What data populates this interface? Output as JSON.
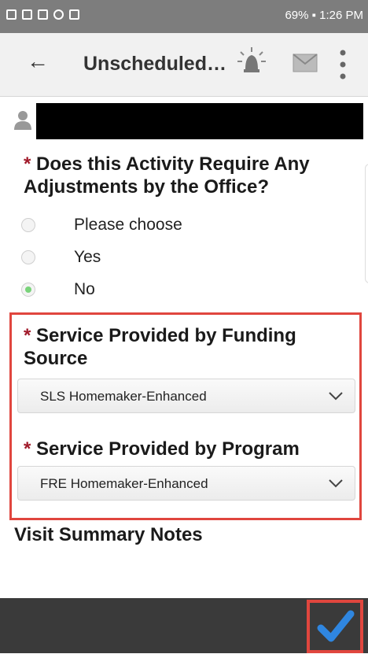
{
  "status_bar": {
    "right_text": "69% ▪ 1:26 PM"
  },
  "app_bar": {
    "back_glyph": "←",
    "title": "Unscheduled…",
    "icons": [
      "alarm-icon",
      "mail-icon",
      "more-vert-icon"
    ]
  },
  "user": {
    "name_redacted": ""
  },
  "question": {
    "required_mark": "*",
    "text": "Does this Activity Require Any Adjustments by the Office?",
    "options": [
      {
        "label": "Please choose",
        "checked": false
      },
      {
        "label": "Yes",
        "checked": false
      },
      {
        "label": "No",
        "checked": true
      }
    ]
  },
  "funding_source": {
    "required_mark": "*",
    "label": "Service Provided by Funding Source",
    "value": "SLS Homemaker-Enhanced"
  },
  "program": {
    "required_mark": "*",
    "label": "Service Provided by Program",
    "value": "FRE Homemaker-Enhanced"
  },
  "notes": {
    "label": "Visit Summary Notes"
  },
  "colors": {
    "accent_check": "#2f86e0",
    "highlight": "#e0463e",
    "required": "#a11a2a",
    "radio_selected": "#79d37a"
  }
}
